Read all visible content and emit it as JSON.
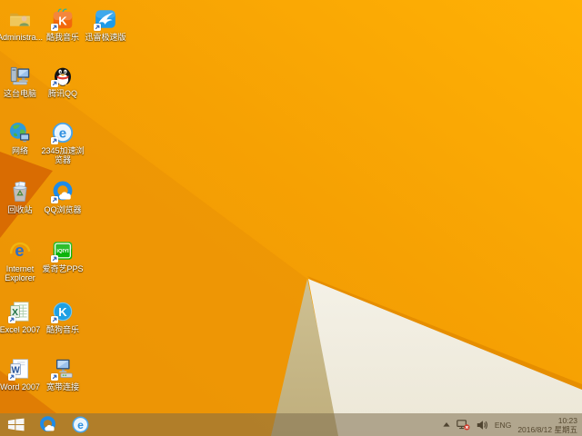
{
  "colors": {
    "wall_bright": "#FFB105",
    "wall_base": "#F6A103",
    "wall_left": "#EC9406",
    "wall_wedge": "#D96C02",
    "wall_wedge2": "#E07D04",
    "wall_stripe": "#E68E00",
    "wall_tan_light": "#CEC092",
    "wall_tan_dark": "#BFAE7C",
    "wall_white": "#F4F1E7",
    "wall_white_dim": "#ECE7D6",
    "taskbar_tint": "#7A6A4A",
    "tray_text": "#564930",
    "label_text": "#FFFFFF",
    "qq_blue": "#1E8BE8",
    "iqiyi_green": "#0BB40B",
    "kuwo_orange": "#F2680C",
    "xunlei_blue": "#1E9BE9",
    "network_error_red": "#D23B2B"
  },
  "desktop": {
    "icons": [
      {
        "name": "administrator-folder",
        "type": "folderUser",
        "label_lines": [
          "Administra..."
        ],
        "col": 0,
        "row": 0,
        "shortcut": false
      },
      {
        "name": "kuwo-music",
        "type": "kuwo",
        "label_lines": [
          "酷我音乐"
        ],
        "col": 1,
        "row": 0,
        "shortcut": true
      },
      {
        "name": "xunlei-speed",
        "type": "xunlei",
        "label_lines": [
          "迅雷极速版"
        ],
        "col": 2,
        "row": 0,
        "shortcut": true
      },
      {
        "name": "this-pc",
        "type": "thispc",
        "label_lines": [
          "这台电脑"
        ],
        "col": 0,
        "row": 1,
        "shortcut": false
      },
      {
        "name": "tencent-qq",
        "type": "qq",
        "label_lines": [
          "腾讯QQ"
        ],
        "col": 1,
        "row": 1,
        "shortcut": true
      },
      {
        "name": "network",
        "type": "network",
        "label_lines": [
          "网络"
        ],
        "col": 0,
        "row": 2,
        "shortcut": false
      },
      {
        "name": "2345-speed-browser",
        "type": "e2345",
        "label_lines": [
          "2345加速浏",
          "览器"
        ],
        "col": 1,
        "row": 2,
        "shortcut": true
      },
      {
        "name": "recycle-bin",
        "type": "recycle",
        "label_lines": [
          "回收站"
        ],
        "col": 0,
        "row": 3,
        "shortcut": false
      },
      {
        "name": "qq-browser",
        "type": "qqbrowser",
        "label_lines": [
          "QQ浏览器"
        ],
        "col": 1,
        "row": 3,
        "shortcut": true
      },
      {
        "name": "internet-explorer",
        "type": "ie",
        "label_lines": [
          "Internet",
          "Explorer"
        ],
        "col": 0,
        "row": 4,
        "shortcut": false
      },
      {
        "name": "iqiyi-pps",
        "type": "iqiyi",
        "label_lines": [
          "爱奇艺PPS"
        ],
        "col": 1,
        "row": 4,
        "shortcut": true
      },
      {
        "name": "excel-2007",
        "type": "excel",
        "label_lines": [
          "Excel 2007"
        ],
        "col": 0,
        "row": 5,
        "shortcut": true
      },
      {
        "name": "kugou-music",
        "type": "kugou",
        "label_lines": [
          "酷狗音乐"
        ],
        "col": 1,
        "row": 5,
        "shortcut": true
      },
      {
        "name": "word-2007",
        "type": "word",
        "label_lines": [
          "Word 2007"
        ],
        "col": 0,
        "row": 6,
        "shortcut": true
      },
      {
        "name": "broadband-connection",
        "type": "broadband",
        "label_lines": [
          "宽带连接"
        ],
        "col": 1,
        "row": 6,
        "shortcut": true
      }
    ]
  },
  "taskbar": {
    "start_icon": "windows-start",
    "apps": [
      {
        "name": "qq-browser",
        "type": "qqbrowser"
      },
      {
        "name": "2345-speed-browser",
        "type": "e2345"
      }
    ],
    "tray_icons": [
      "show-hidden-icons",
      "network-disconnected",
      "volume"
    ],
    "language": "ENG",
    "time": "10:23",
    "date": "2016/8/12 星期五"
  }
}
